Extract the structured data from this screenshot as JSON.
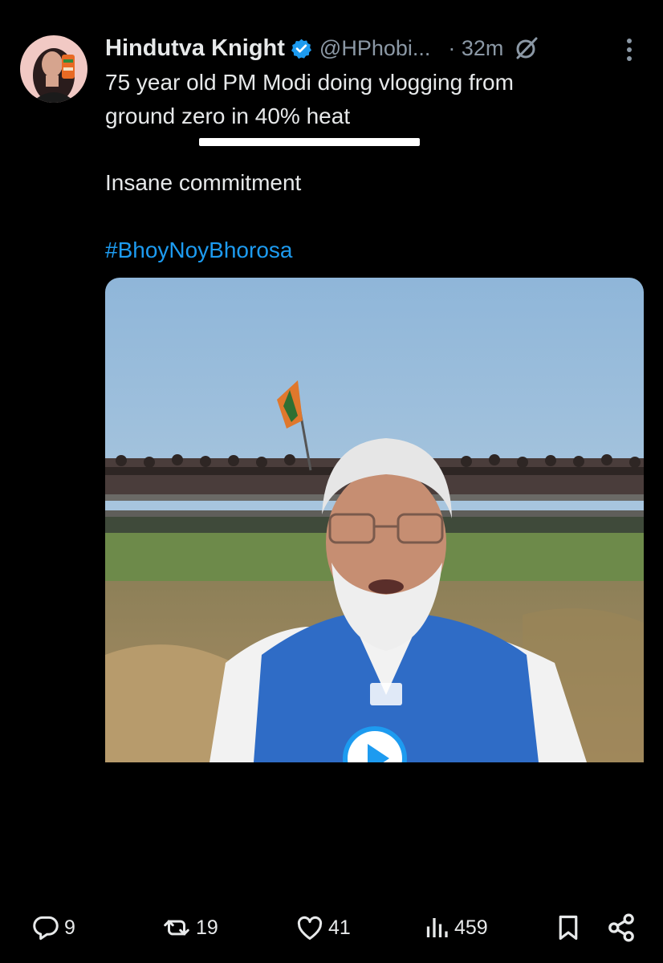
{
  "tweet": {
    "author": {
      "display_name": "Hindutva Knight",
      "handle": "@HPhobi...",
      "verified": true
    },
    "time": "· 32m",
    "text_line1": "75 year old PM Modi doing vlogging from",
    "text_line2": "ground zero in 40% heat",
    "text_line3": "Insane commitment",
    "hashtag": "#BhoyNoyBhorosa",
    "media": {
      "type": "video",
      "icon": "play-icon"
    }
  },
  "actions": {
    "replies": "9",
    "reposts": "19",
    "likes": "41",
    "views": "459"
  },
  "colors": {
    "background": "#000000",
    "text": "#e7e9ea",
    "secondary": "#8b98a5",
    "accent": "#1d9bf0"
  },
  "icons": [
    "verified-badge-icon",
    "grok-icon",
    "more-icon",
    "reply-icon",
    "repost-icon",
    "like-icon",
    "views-icon",
    "bookmark-icon",
    "share-icon",
    "play-icon"
  ]
}
